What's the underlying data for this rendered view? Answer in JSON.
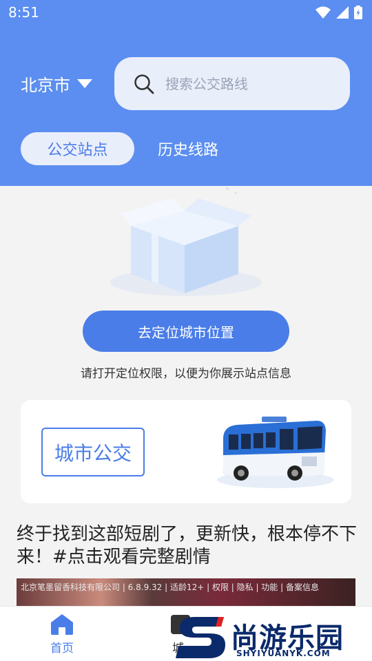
{
  "status_bar": {
    "time": "8:51"
  },
  "header": {
    "city": "北京市",
    "search_placeholder": "搜索公交路线",
    "tabs": [
      {
        "label": "公交站点",
        "active": true
      },
      {
        "label": "历史线路",
        "active": false
      }
    ]
  },
  "empty_state": {
    "button_label": "去定位城市位置",
    "hint": "请打开定位权限，以便为你展示站点信息"
  },
  "city_bus_card": {
    "label": "城市公交"
  },
  "ad": {
    "title": "终于找到这部短剧了，更新快，根本停不下来！#点击观看完整剧情",
    "info": "北京笔墨留香科技有限公司 | 6.8.9.32 | 适龄12+ | 权限 | 隐私 | 功能 | 备案信息"
  },
  "bottom_nav": {
    "items": [
      {
        "label": "首页",
        "active": true
      },
      {
        "label": "城",
        "active": false
      }
    ]
  },
  "watermark": {
    "brand": "尚游乐园",
    "url": "SHYIYUANYK.COM"
  },
  "colors": {
    "primary": "#5b8ef0",
    "accent": "#4a7de8",
    "tab_bg": "#e9eefb",
    "background": "#f3f3f3"
  }
}
